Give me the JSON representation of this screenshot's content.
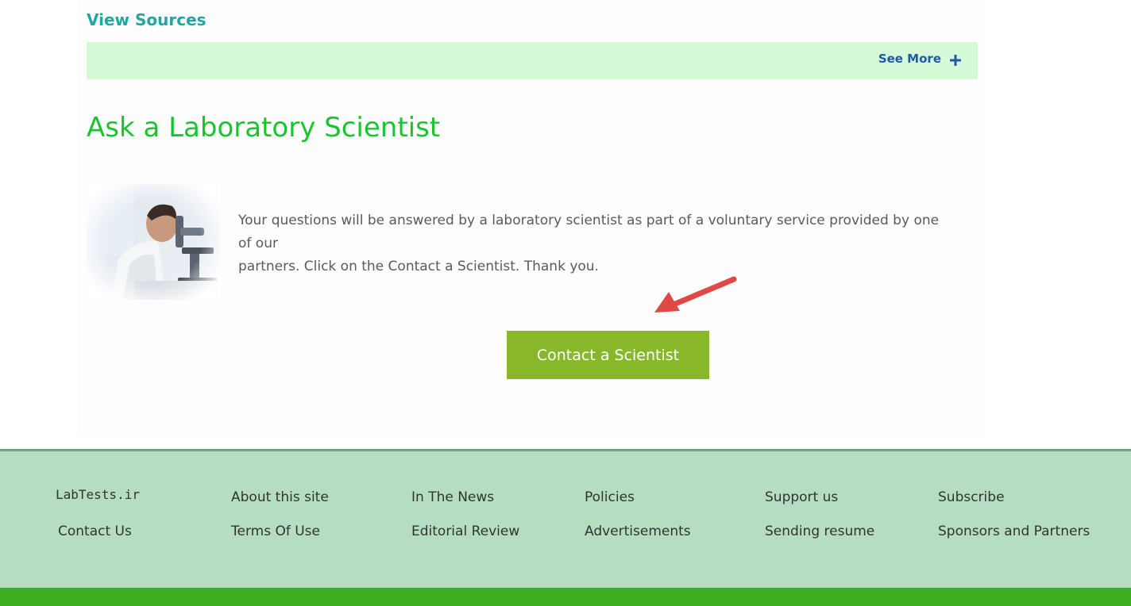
{
  "view_sources": {
    "label": "View Sources"
  },
  "see_more": {
    "label": "See More",
    "icon": "plus-icon"
  },
  "ask_section": {
    "title": "Ask a Laboratory Scientist",
    "body_line1": "Your questions will be answered by a laboratory scientist as part of a voluntary service provided by one of our",
    "body_line2": "partners. Click on the Contact a Scientist. Thank you.",
    "button_label": "Contact a Scientist"
  },
  "footer": {
    "columns": [
      [
        "LabTests.ir",
        "Contact Us"
      ],
      [
        "About this site",
        "Terms Of Use"
      ],
      [
        "In The News",
        "Editorial Review"
      ],
      [
        "Policies",
        "Advertisements"
      ],
      [
        "Support us",
        "Sending resume"
      ],
      [
        "Subscribe",
        "Sponsors and Partners"
      ]
    ]
  },
  "colors": {
    "accent_teal": "#21a6a0",
    "title_green": "#19c52e",
    "button_green": "#88b82a",
    "footer_bg": "#b5ddc2",
    "bottom_bar": "#3eae21",
    "see_more_bar": "#d4fad8",
    "arrow_red": "#e04a45"
  }
}
